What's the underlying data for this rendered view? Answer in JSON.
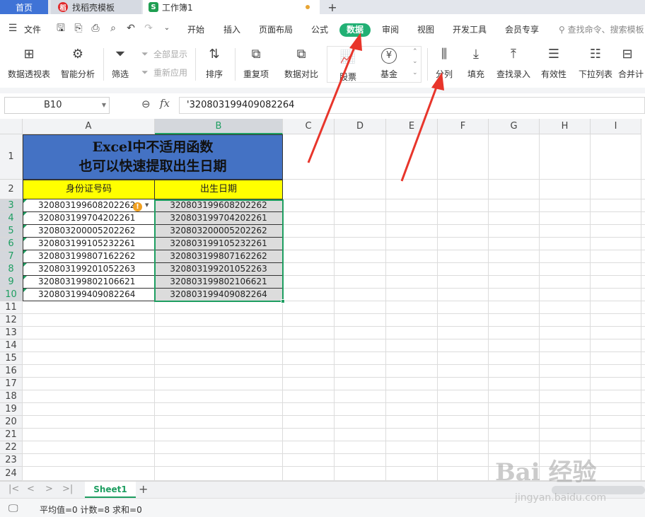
{
  "tabs": {
    "home": "首页",
    "templates": "找稻壳模板",
    "workbook": "工作簿1",
    "templates_icon": "稻",
    "workbook_icon": "S"
  },
  "menu": {
    "file": "文件",
    "items": [
      "开始",
      "插入",
      "页面布局",
      "公式",
      "数据",
      "审阅",
      "视图",
      "开发工具",
      "会员专享"
    ],
    "search": "查找命令、搜索模板"
  },
  "ribbon": {
    "pivot": "数据透视表",
    "smart": "智能分析",
    "filter": "筛选",
    "show_all": "全部显示",
    "reapply": "重新应用",
    "sort": "排序",
    "duplicates": "重复项",
    "compare": "数据对比",
    "stock": "股票",
    "fund": "基金",
    "split": "分列",
    "fill": "填充",
    "lookup": "查找录入",
    "validity": "有效性",
    "dropdown": "下拉列表",
    "merge": "合并计"
  },
  "formula_bar": {
    "name_box": "B10",
    "fx": "fx",
    "content": "'320803199409082264"
  },
  "grid": {
    "columns": [
      "A",
      "B",
      "C",
      "D",
      "E",
      "F",
      "G",
      "H",
      "I"
    ],
    "rows": [
      "1",
      "2",
      "3",
      "4",
      "5",
      "6",
      "7",
      "8",
      "9",
      "10",
      "11",
      "12",
      "13",
      "14",
      "15",
      "16",
      "17",
      "18",
      "19",
      "20",
      "21",
      "22",
      "23",
      "24"
    ],
    "title_line1": "Excel中不适用函数",
    "title_line2": "也可以快速提取出生日期",
    "header_a": "身份证号码",
    "header_b": "出生日期",
    "col_a": [
      "320803199608202262",
      "320803199704202261",
      "320803200005202262",
      "320803199105232261",
      "320803199807162262",
      "320803199201052263",
      "320803199802106621",
      "320803199409082264"
    ],
    "col_b": [
      "320803199608202262",
      "320803199704202261",
      "320803200005202262",
      "320803199105232261",
      "320803199807162262",
      "320803199201052263",
      "320803199802106621",
      "320803199409082264"
    ]
  },
  "sheet": {
    "tab": "Sheet1"
  },
  "status": {
    "summary": "平均值=0  计数=8  求和=0"
  },
  "colors": {
    "accent": "#1e9e61",
    "title_fill": "#4472c4",
    "header_fill": "#ffff00",
    "arrow": "#e8352b"
  },
  "watermark": {
    "brand": "Bai 经验",
    "url": "jingyan.baidu.com"
  }
}
